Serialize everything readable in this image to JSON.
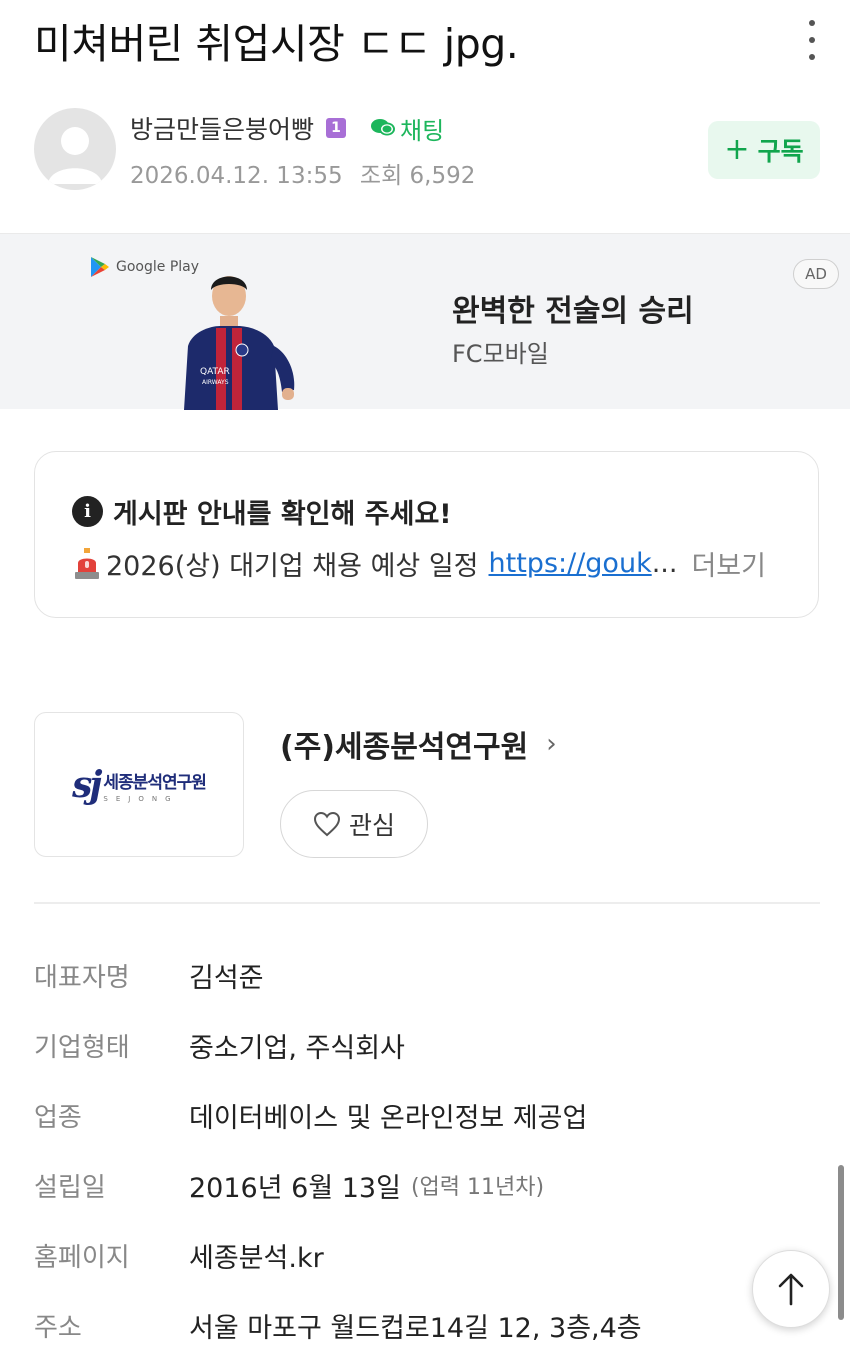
{
  "post": {
    "title": "미쳐버린 취업시장 ㄷㄷ jpg.",
    "author": "방금만들은붕어빵",
    "level": "1",
    "chat_label": "채팅",
    "date": "2026.04.12. 13:55",
    "views_label": "조회 6,592",
    "subscribe_label": "구독"
  },
  "ad": {
    "store": "Google Play",
    "headline": "완벽한 전술의 승리",
    "brand": "FC모바일",
    "badge": "AD",
    "jersey_text_1": "QATAR",
    "jersey_text_2": "AIRWAYS"
  },
  "notice": {
    "title": "게시판 안내를 확인해 주세요!",
    "text": "2026(상) 대기업 채용 예상 일정",
    "link": "https://gouk",
    "ellipsis": "...",
    "more": "더보기"
  },
  "company": {
    "logo_mark": "sj",
    "logo_name": "세종분석연구원",
    "logo_eng": "SEJONG",
    "name": "(주)세종분석연구원",
    "follow_label": "관심",
    "info": [
      {
        "label": "대표자명",
        "value": "김석준",
        "sub": ""
      },
      {
        "label": "기업형태",
        "value": "중소기업, 주식회사",
        "sub": ""
      },
      {
        "label": "업종",
        "value": "데이터베이스 및 온라인정보 제공업",
        "sub": ""
      },
      {
        "label": "설립일",
        "value": "2016년 6월 13일",
        "sub": "(업력 11년차)"
      },
      {
        "label": "홈페이지",
        "value": "세종분석.kr",
        "sub": ""
      },
      {
        "label": "주소",
        "value": "서울 마포구 월드컵로14길 12, 3층,4층",
        "sub": ""
      }
    ]
  },
  "colors": {
    "accent_green": "#1db65c",
    "link_blue": "#1a6fd0",
    "logo_navy": "#1f2d7a",
    "level_purple": "#a86fd6"
  },
  "icons": [
    "more-vertical-icon",
    "chat-bubble-icon",
    "plus-icon",
    "google-play-icon",
    "info-icon",
    "siren-icon",
    "chevron-right-icon",
    "heart-icon",
    "arrow-up-icon"
  ]
}
